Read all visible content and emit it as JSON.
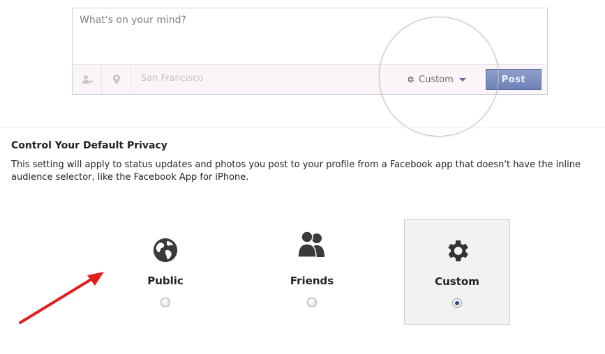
{
  "composer": {
    "placeholder": "What's on your mind?",
    "location_value": "San Francisco",
    "tag_people_icon": "add-person-icon",
    "location_icon": "location-pin-icon",
    "audience_label": "Custom",
    "post_label": "Post"
  },
  "privacy": {
    "title": "Control Your Default Privacy",
    "description": "This setting will apply to status updates and photos you post to your profile from a Facebook app that doesn't have the inline audience selector, like the Facebook App for iPhone.",
    "options": [
      {
        "label": "Public",
        "icon": "globe-icon",
        "selected": false
      },
      {
        "label": "Friends",
        "icon": "friends-icon",
        "selected": false
      },
      {
        "label": "Custom",
        "icon": "gear-icon",
        "selected": true
      }
    ]
  },
  "colors": {
    "accent": "#6f82b8",
    "arrow": "#e0201f",
    "selected_radio": "#2a4b8d"
  }
}
